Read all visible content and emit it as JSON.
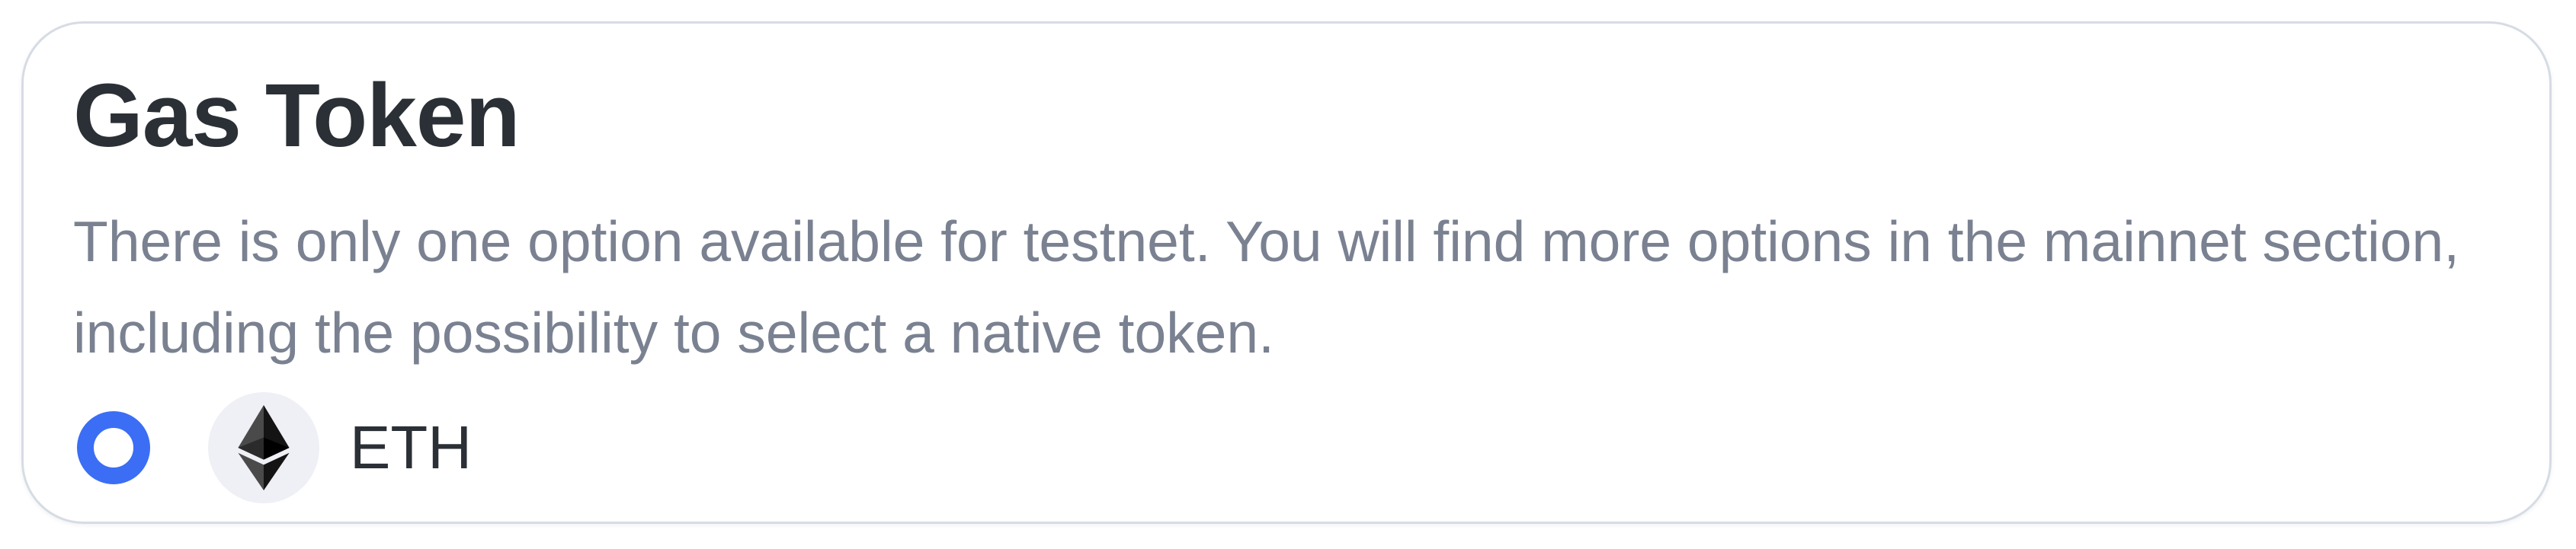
{
  "card": {
    "title": "Gas Token",
    "description": "There is only one option available for testnet. You will find more options in the mainnet section, including the possibility to select a native token."
  },
  "options": [
    {
      "label": "ETH",
      "icon": "ethereum-icon",
      "selected": true
    }
  ],
  "colors": {
    "accent": "#3b6ef5",
    "title_text": "#2b3036",
    "description_text": "#7a8191",
    "card_border": "#d6dce4",
    "icon_background": "#eef0f5"
  }
}
